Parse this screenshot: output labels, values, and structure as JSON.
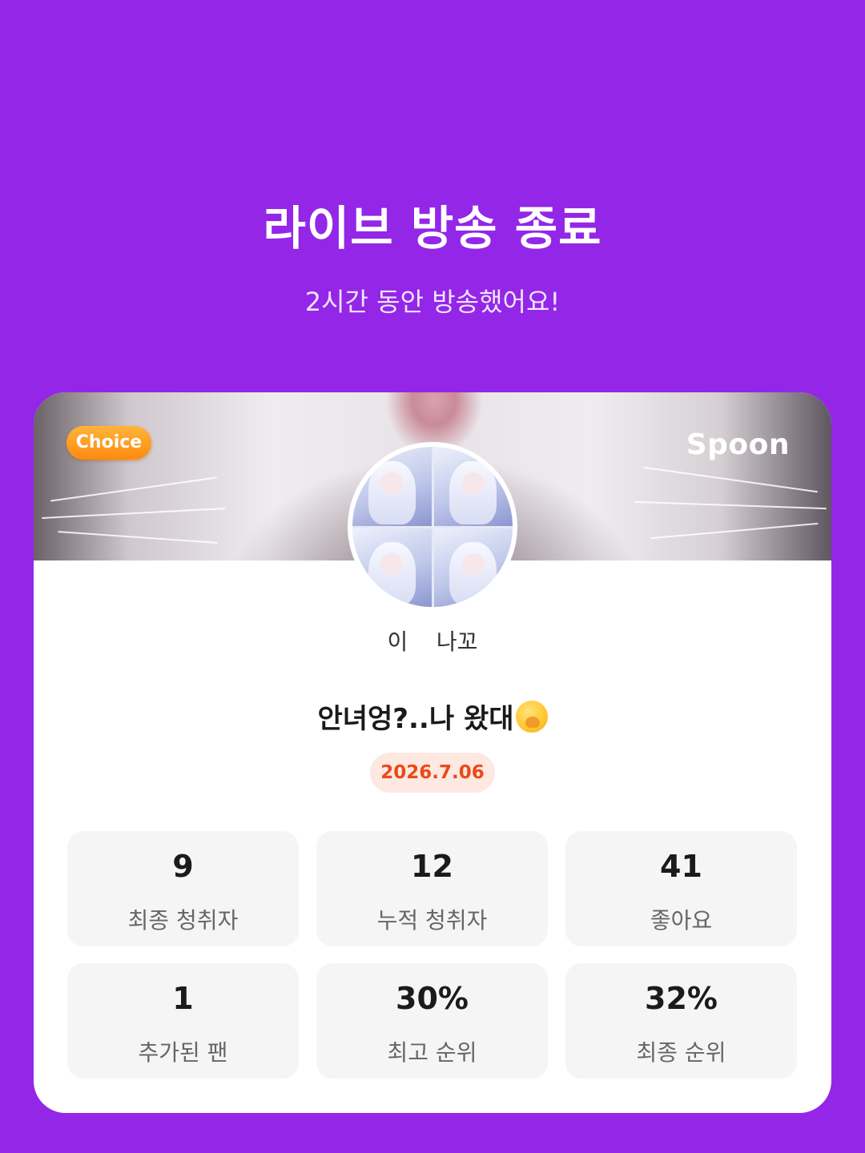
{
  "header": {
    "title": "라이브 방송 종료",
    "subtitle": "2시간 동안 방송했어요!"
  },
  "card": {
    "choice_badge": "Choice",
    "brand_logo": "Spoon",
    "streamer_name": "이    나꼬",
    "live_title": "안녀엉?..나 왔대",
    "title_emoji": "hand-over-mouth-emoji",
    "date": "2026.7.06",
    "stats": [
      {
        "value": "9",
        "label": "최종 청취자"
      },
      {
        "value": "12",
        "label": "누적 청취자"
      },
      {
        "value": "41",
        "label": "좋아요"
      },
      {
        "value": "1",
        "label": "추가된 팬"
      },
      {
        "value": "30%",
        "label": "최고 순위"
      },
      {
        "value": "32%",
        "label": "최종 순위"
      }
    ]
  },
  "colors": {
    "background": "#9426e8",
    "card": "#ffffff",
    "choice_badge": "#ff9a1f",
    "date_text": "#ea4a17",
    "date_bg": "#fde8e2",
    "stat_bg": "#f5f5f6"
  }
}
